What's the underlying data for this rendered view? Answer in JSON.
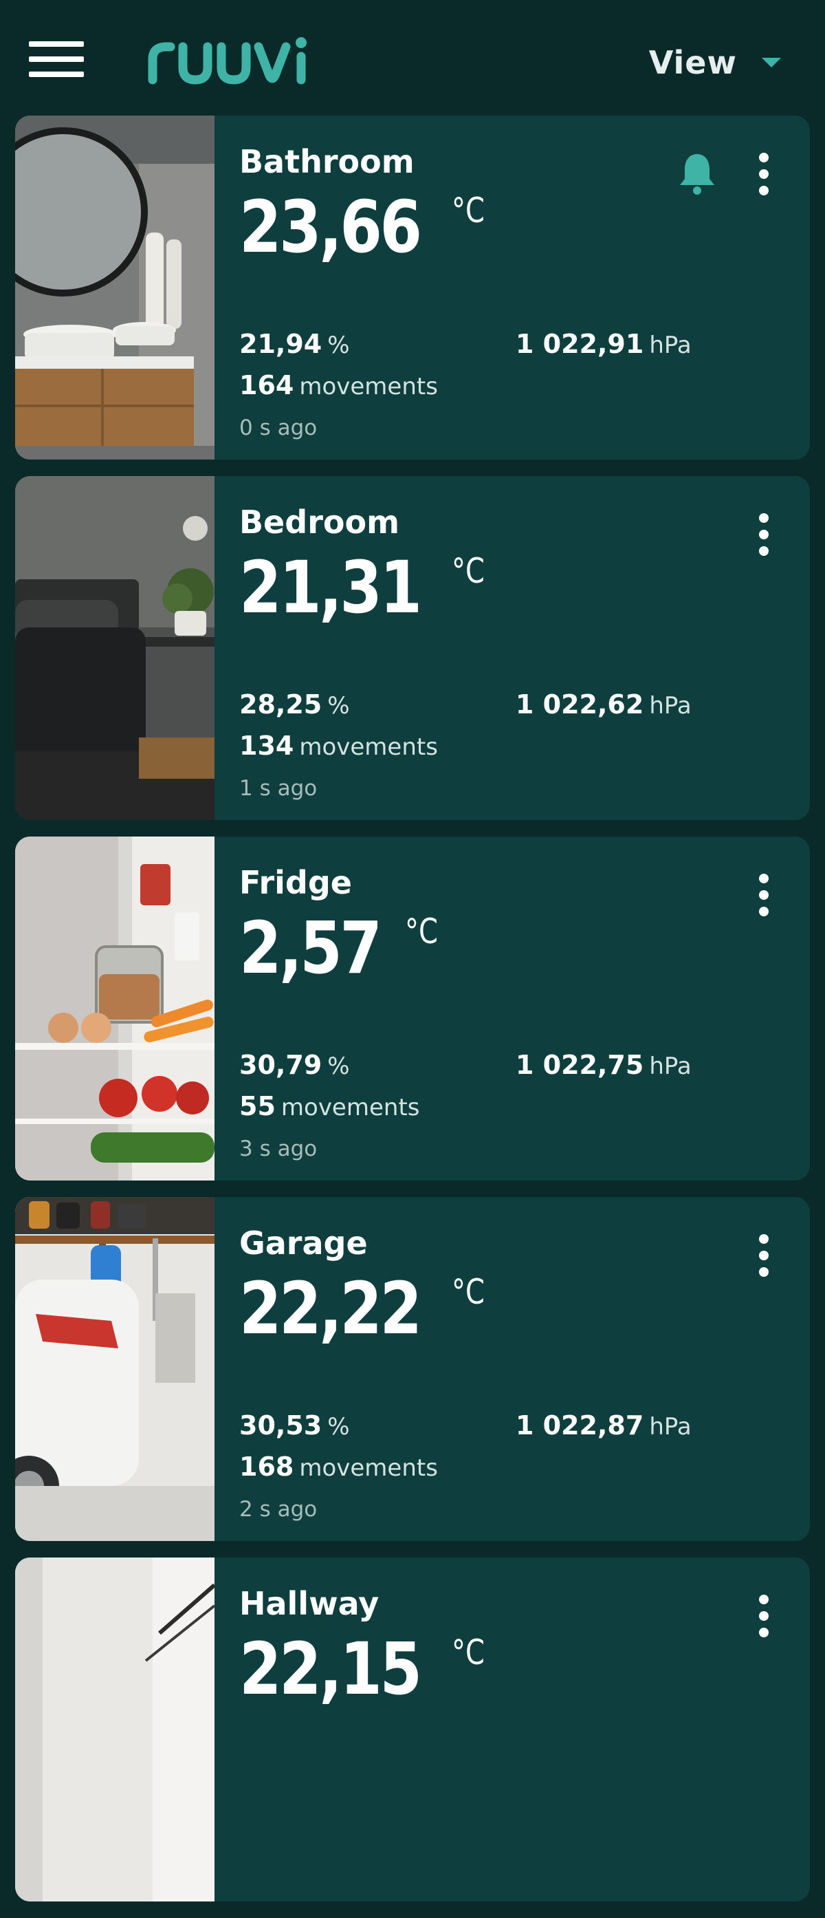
{
  "app": {
    "brand": "ruuvi",
    "view_label": "View",
    "colors": {
      "background": "#0a2a2a",
      "card": "#0e3f3e",
      "accent": "#3fb4a6"
    }
  },
  "sensors": [
    {
      "name": "Bathroom",
      "temperature": "23,66",
      "temp_unit": "°C",
      "humidity": "21,94",
      "humidity_unit": "%",
      "pressure": "1 022,91",
      "pressure_unit": "hPa",
      "movements": "164",
      "movements_unit": "movements",
      "updated": "0 s ago",
      "alert": true,
      "image": "bathroom"
    },
    {
      "name": "Bedroom",
      "temperature": "21,31",
      "temp_unit": "°C",
      "humidity": "28,25",
      "humidity_unit": "%",
      "pressure": "1 022,62",
      "pressure_unit": "hPa",
      "movements": "134",
      "movements_unit": "movements",
      "updated": "1 s ago",
      "alert": false,
      "image": "bedroom"
    },
    {
      "name": "Fridge",
      "temperature": "2,57",
      "temp_unit": "°C",
      "humidity": "30,79",
      "humidity_unit": "%",
      "pressure": "1 022,75",
      "pressure_unit": "hPa",
      "movements": "55",
      "movements_unit": "movements",
      "updated": "3 s ago",
      "alert": false,
      "image": "fridge"
    },
    {
      "name": "Garage",
      "temperature": "22,22",
      "temp_unit": "°C",
      "humidity": "30,53",
      "humidity_unit": "%",
      "pressure": "1 022,87",
      "pressure_unit": "hPa",
      "movements": "168",
      "movements_unit": "movements",
      "updated": "2 s ago",
      "alert": false,
      "image": "garage"
    },
    {
      "name": "Hallway",
      "temperature": "22,15",
      "temp_unit": "°C",
      "humidity": "",
      "humidity_unit": "",
      "pressure": "",
      "pressure_unit": "",
      "movements": "",
      "movements_unit": "",
      "updated": "",
      "alert": false,
      "image": "hallway"
    }
  ]
}
